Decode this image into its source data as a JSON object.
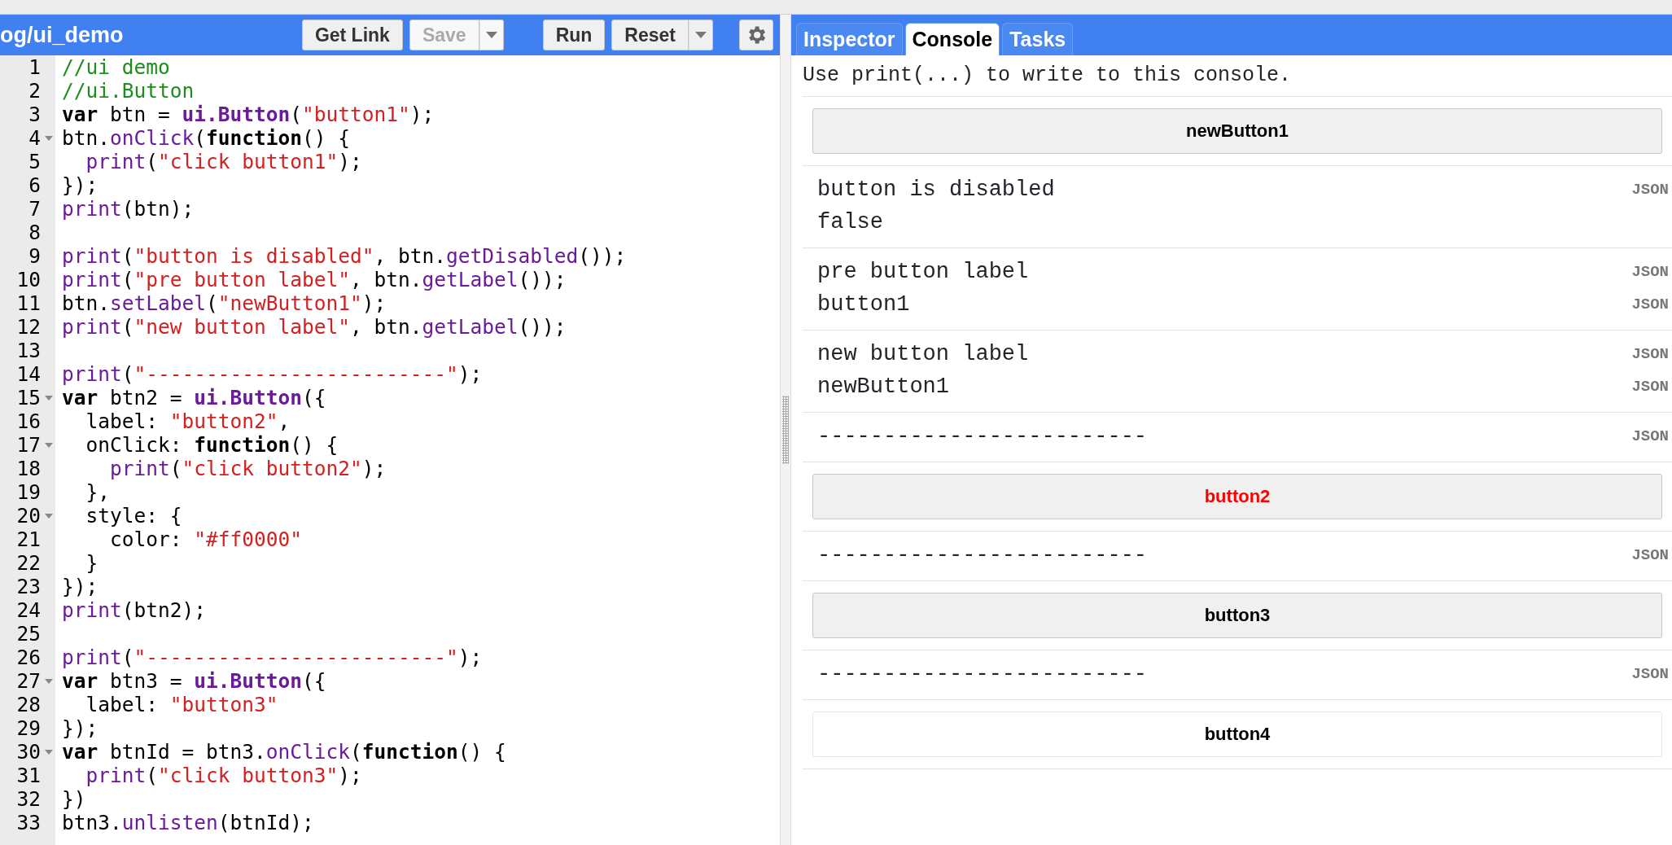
{
  "editor": {
    "title": "og/ui_demo",
    "buttons": [
      {
        "label": "Get Link",
        "disabled": false,
        "dropdown": false
      },
      {
        "label": "Save",
        "disabled": true,
        "dropdown": true
      },
      {
        "label": "Run",
        "disabled": false,
        "dropdown": false
      },
      {
        "label": "Reset",
        "disabled": false,
        "dropdown": true
      }
    ],
    "lines": [
      {
        "number": "1",
        "foldable": false,
        "tokens": [
          {
            "kind": "comment",
            "text": "//ui demo"
          }
        ]
      },
      {
        "number": "2",
        "foldable": false,
        "tokens": [
          {
            "kind": "comment",
            "text": "//ui.Button"
          }
        ]
      },
      {
        "number": "3",
        "foldable": false,
        "tokens": [
          {
            "kind": "keyword",
            "text": "var"
          },
          {
            "kind": "plain",
            "text": " btn = "
          },
          {
            "kind": "ui",
            "text": "ui.Button"
          },
          {
            "kind": "plain",
            "text": "("
          },
          {
            "kind": "string",
            "text": "\"button1\""
          },
          {
            "kind": "plain",
            "text": ");"
          }
        ]
      },
      {
        "number": "4",
        "foldable": true,
        "tokens": [
          {
            "kind": "plain",
            "text": "btn."
          },
          {
            "kind": "method",
            "text": "onClick"
          },
          {
            "kind": "plain",
            "text": "("
          },
          {
            "kind": "keyword",
            "text": "function"
          },
          {
            "kind": "plain",
            "text": "() {"
          }
        ]
      },
      {
        "number": "5",
        "foldable": false,
        "tokens": [
          {
            "kind": "method",
            "text": "  print"
          },
          {
            "kind": "plain",
            "text": "("
          },
          {
            "kind": "string",
            "text": "\"click button1\""
          },
          {
            "kind": "plain",
            "text": ");"
          }
        ]
      },
      {
        "number": "6",
        "foldable": false,
        "tokens": [
          {
            "kind": "plain",
            "text": "});"
          }
        ]
      },
      {
        "number": "7",
        "foldable": false,
        "tokens": [
          {
            "kind": "method",
            "text": "print"
          },
          {
            "kind": "plain",
            "text": "(btn);"
          }
        ]
      },
      {
        "number": "8",
        "foldable": false
      },
      {
        "number": "9",
        "foldable": false,
        "tokens": [
          {
            "kind": "method",
            "text": "print"
          },
          {
            "kind": "plain",
            "text": "("
          },
          {
            "kind": "string",
            "text": "\"button is disabled\""
          },
          {
            "kind": "plain",
            "text": ", btn."
          },
          {
            "kind": "method",
            "text": "getDisabled"
          },
          {
            "kind": "plain",
            "text": "());"
          }
        ]
      },
      {
        "number": "10",
        "foldable": false,
        "tokens": [
          {
            "kind": "method",
            "text": "print"
          },
          {
            "kind": "plain",
            "text": "("
          },
          {
            "kind": "string",
            "text": "\"pre button label\""
          },
          {
            "kind": "plain",
            "text": ", btn."
          },
          {
            "kind": "method",
            "text": "getLabel"
          },
          {
            "kind": "plain",
            "text": "());"
          }
        ]
      },
      {
        "number": "11",
        "foldable": false,
        "tokens": [
          {
            "kind": "plain",
            "text": "btn."
          },
          {
            "kind": "method",
            "text": "setLabel"
          },
          {
            "kind": "plain",
            "text": "("
          },
          {
            "kind": "string",
            "text": "\"newButton1\""
          },
          {
            "kind": "plain",
            "text": ");"
          }
        ]
      },
      {
        "number": "12",
        "foldable": false,
        "tokens": [
          {
            "kind": "method",
            "text": "print"
          },
          {
            "kind": "plain",
            "text": "("
          },
          {
            "kind": "string",
            "text": "\"new button label\""
          },
          {
            "kind": "plain",
            "text": ", btn."
          },
          {
            "kind": "method",
            "text": "getLabel"
          },
          {
            "kind": "plain",
            "text": "());"
          }
        ]
      },
      {
        "number": "13",
        "foldable": false
      },
      {
        "number": "14",
        "foldable": false,
        "tokens": [
          {
            "kind": "method",
            "text": "print"
          },
          {
            "kind": "plain",
            "text": "("
          },
          {
            "kind": "string",
            "text": "\"-------------------------\""
          },
          {
            "kind": "plain",
            "text": ");"
          }
        ]
      },
      {
        "number": "15",
        "foldable": true,
        "tokens": [
          {
            "kind": "keyword",
            "text": "var"
          },
          {
            "kind": "plain",
            "text": " btn2 = "
          },
          {
            "kind": "ui",
            "text": "ui.Button"
          },
          {
            "kind": "plain",
            "text": "({"
          }
        ]
      },
      {
        "number": "16",
        "foldable": false,
        "tokens": [
          {
            "kind": "plain",
            "text": "  label: "
          },
          {
            "kind": "string",
            "text": "\"button2\""
          },
          {
            "kind": "plain",
            "text": ","
          }
        ]
      },
      {
        "number": "17",
        "foldable": true,
        "tokens": [
          {
            "kind": "plain",
            "text": "  onClick: "
          },
          {
            "kind": "keyword",
            "text": "function"
          },
          {
            "kind": "plain",
            "text": "() {"
          }
        ]
      },
      {
        "number": "18",
        "foldable": false,
        "tokens": [
          {
            "kind": "method",
            "text": "    print"
          },
          {
            "kind": "plain",
            "text": "("
          },
          {
            "kind": "string",
            "text": "\"click button2\""
          },
          {
            "kind": "plain",
            "text": ");"
          }
        ]
      },
      {
        "number": "19",
        "foldable": false,
        "tokens": [
          {
            "kind": "plain",
            "text": "  },"
          }
        ]
      },
      {
        "number": "20",
        "foldable": true,
        "tokens": [
          {
            "kind": "plain",
            "text": "  style: {"
          }
        ]
      },
      {
        "number": "21",
        "foldable": false,
        "tokens": [
          {
            "kind": "plain",
            "text": "    color: "
          },
          {
            "kind": "string",
            "text": "\"#ff0000\""
          }
        ]
      },
      {
        "number": "22",
        "foldable": false,
        "tokens": [
          {
            "kind": "plain",
            "text": "  }"
          }
        ]
      },
      {
        "number": "23",
        "foldable": false,
        "tokens": [
          {
            "kind": "plain",
            "text": "});"
          }
        ]
      },
      {
        "number": "24",
        "foldable": false,
        "tokens": [
          {
            "kind": "method",
            "text": "print"
          },
          {
            "kind": "plain",
            "text": "(btn2);"
          }
        ]
      },
      {
        "number": "25",
        "foldable": false
      },
      {
        "number": "26",
        "foldable": false,
        "tokens": [
          {
            "kind": "method",
            "text": "print"
          },
          {
            "kind": "plain",
            "text": "("
          },
          {
            "kind": "string",
            "text": "\"-------------------------\""
          },
          {
            "kind": "plain",
            "text": ");"
          }
        ]
      },
      {
        "number": "27",
        "foldable": true,
        "tokens": [
          {
            "kind": "keyword",
            "text": "var"
          },
          {
            "kind": "plain",
            "text": " btn3 = "
          },
          {
            "kind": "ui",
            "text": "ui.Button"
          },
          {
            "kind": "plain",
            "text": "({"
          }
        ]
      },
      {
        "number": "28",
        "foldable": false,
        "tokens": [
          {
            "kind": "plain",
            "text": "  label: "
          },
          {
            "kind": "string",
            "text": "\"button3\""
          }
        ]
      },
      {
        "number": "29",
        "foldable": false,
        "tokens": [
          {
            "kind": "plain",
            "text": "});"
          }
        ]
      },
      {
        "number": "30",
        "foldable": true,
        "tokens": [
          {
            "kind": "keyword",
            "text": "var"
          },
          {
            "kind": "plain",
            "text": " btnId = btn3."
          },
          {
            "kind": "method",
            "text": "onClick"
          },
          {
            "kind": "plain",
            "text": "("
          },
          {
            "kind": "keyword",
            "text": "function"
          },
          {
            "kind": "plain",
            "text": "() {"
          }
        ]
      },
      {
        "number": "31",
        "foldable": false,
        "tokens": [
          {
            "kind": "method",
            "text": "  print"
          },
          {
            "kind": "plain",
            "text": "("
          },
          {
            "kind": "string",
            "text": "\"click button3\""
          },
          {
            "kind": "plain",
            "text": ");"
          }
        ]
      },
      {
        "number": "32",
        "foldable": false,
        "tokens": [
          {
            "kind": "plain",
            "text": "})"
          }
        ]
      },
      {
        "number": "33",
        "foldable": false,
        "tokens": [
          {
            "kind": "plain",
            "text": "btn3."
          },
          {
            "kind": "method",
            "text": "unlisten"
          },
          {
            "kind": "plain",
            "text": "(btnId);"
          }
        ]
      }
    ]
  },
  "panel": {
    "tabs": [
      {
        "label": "Inspector",
        "selected": false
      },
      {
        "label": "Console",
        "selected": true
      },
      {
        "label": "Tasks",
        "selected": false
      }
    ],
    "hint": "Use print(...) to write to this console.",
    "entries": [
      {
        "kind": "button",
        "label": "newButton1",
        "shaded": true
      },
      {
        "kind": "text",
        "lines": [
          {
            "text": "button is disabled",
            "json": "JSON"
          },
          {
            "text": "false"
          }
        ]
      },
      {
        "kind": "text",
        "lines": [
          {
            "text": "pre button label",
            "json": "JSON"
          },
          {
            "text": "button1",
            "json": "JSON"
          }
        ]
      },
      {
        "kind": "text",
        "lines": [
          {
            "text": "new button label",
            "json": "JSON"
          },
          {
            "text": "newButton1",
            "json": "JSON"
          }
        ]
      },
      {
        "kind": "text",
        "lines": [
          {
            "text": "-------------------------",
            "json": "JSON"
          }
        ]
      },
      {
        "kind": "button",
        "label": "button2",
        "shaded": true,
        "color": "#ff0000"
      },
      {
        "kind": "text",
        "lines": [
          {
            "text": "-------------------------",
            "json": "JSON"
          }
        ]
      },
      {
        "kind": "button",
        "label": "button3",
        "shaded": true
      },
      {
        "kind": "text",
        "lines": [
          {
            "text": "-------------------------",
            "json": "JSON"
          }
        ]
      },
      {
        "kind": "button",
        "label": "button4",
        "shaded": false
      }
    ]
  }
}
